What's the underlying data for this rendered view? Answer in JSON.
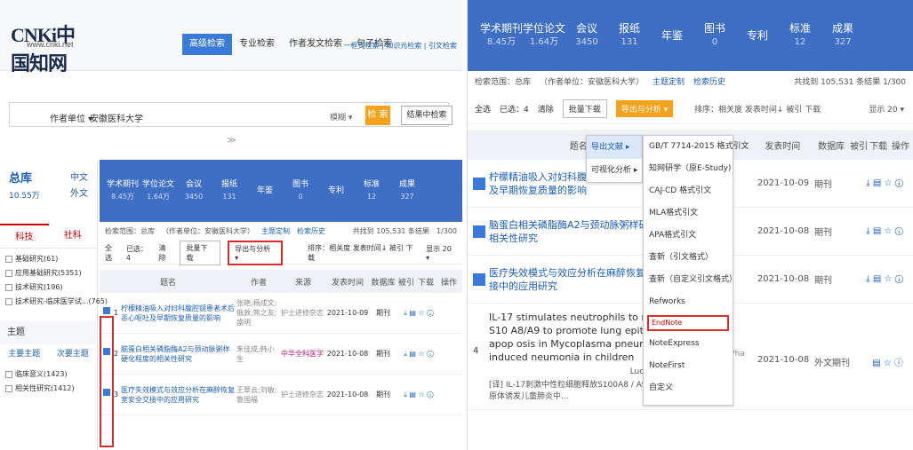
{
  "left": {
    "logo": {
      "mark": "CNKi中国知网",
      "url": "www.cnki.net"
    },
    "search_tabs": [
      "高级检索",
      "专业检索",
      "作者发文检索",
      "句子检索"
    ],
    "top_links": "一框式检索 | 知识元检索 | 引文检索",
    "search": {
      "field": "作者单位 ▾",
      "value": "安徽医科大学",
      "match": "模糊 ▾",
      "button": "检 索",
      "in_result": "结果中检索",
      "expand": "≫"
    },
    "sidebar": {
      "total_title": "总库",
      "total_count": "10.55万",
      "lang_links": [
        "中文",
        "外文"
      ],
      "subject_tabs": [
        "科技",
        "社科"
      ],
      "categories": [
        "基础研究(61)",
        "应用基础研究(5351)",
        "技术研究(196)",
        "技术研究-临床医学试...(765)"
      ],
      "topic_header": "主题",
      "topic_tabs": [
        "主要主题",
        "次要主题"
      ],
      "topics": [
        "临床意义(1423)",
        "相关性研究(1412)"
      ]
    },
    "types": [
      {
        "label": "学术期刊",
        "n": "8.45万"
      },
      {
        "label": "学位论文",
        "n": "1.64万"
      },
      {
        "label": "会议",
        "n": "3450"
      },
      {
        "label": "报纸",
        "n": "131"
      },
      {
        "label": "年鉴",
        "n": ""
      },
      {
        "label": "图书",
        "n": "0"
      },
      {
        "label": "专利",
        "n": ""
      },
      {
        "label": "标准",
        "n": "12"
      },
      {
        "label": "成果",
        "n": "327"
      }
    ],
    "filter": {
      "scope": "检索范围：总库",
      "cond": "（作者单位：安徽医科大学）",
      "custom": "主题定制",
      "history": "检索历史",
      "total": "共找到 105,531 条结果",
      "page": "1/300"
    },
    "toolbar": {
      "select_all": "全选",
      "selected": "已选：4",
      "clear": "清除",
      "batch": "批量下载",
      "export": "导出与分析 ▾",
      "sort": "排序：相关度  发表时间↓ 被引  下载",
      "display": "显示 20 ▾"
    },
    "table_head": [
      "题名",
      "作者",
      "来源",
      "发表时间",
      "数据库",
      "被引",
      "下载",
      "操作"
    ],
    "rows": [
      {
        "idx": "1",
        "title": "柠檬精油吸入对妇科腹腔镜患者术后恶心呕吐及早期恢复质量的影响",
        "author": "张艳;杨成文;俄敦;熊之友;盛明",
        "src": "护士进修杂志",
        "date": "2021-10-09",
        "db": "期刊",
        "ops": "⤓ ▤ ☆ ⓘ"
      },
      {
        "idx": "2",
        "title": "脑蛋白相关磷脂酶A2与颈动脉粥样硬化程度的相关性研究",
        "author": "朱佳成;韩小生",
        "src": "中华全科医学",
        "date": "2021-10-08",
        "db": "期刊",
        "ops": "⤓ ▤ ☆ ⓘ"
      },
      {
        "idx": "3",
        "title": "医疗失效模式与效应分析在麻醉恢复室安全交接中的应用研究",
        "author": "王翠云;刘敏;鲁国福",
        "src": "护士进修杂志",
        "date": "2021-10-08",
        "db": "期刊",
        "ops": "⤓ ▤ ☆ ⓘ"
      }
    ]
  },
  "right": {
    "types": [
      {
        "label": "学术期刊",
        "n": "8.45万"
      },
      {
        "label": "学位论文",
        "n": "1.64万"
      },
      {
        "label": "会议",
        "n": "3450"
      },
      {
        "label": "报纸",
        "n": "131"
      },
      {
        "label": "年鉴",
        "n": ""
      },
      {
        "label": "图书",
        "n": "0"
      },
      {
        "label": "专利",
        "n": ""
      },
      {
        "label": "标准",
        "n": "12"
      },
      {
        "label": "成果",
        "n": "327"
      }
    ],
    "filter": {
      "scope": "检索范围：总库",
      "cond": "（作者单位：安徽医科大学）",
      "custom": "主题定制",
      "history": "检索历史",
      "total": "共找到 105,531 条结果",
      "page": "1/300"
    },
    "toolbar": {
      "select_all": "全选",
      "selected": "已选：4",
      "clear": "清除",
      "batch": "批量下载",
      "export": "导出与分析 ▾",
      "sort": "排序：相关度  发表时间↓ 被引  下载",
      "display": "显示 20 ▾"
    },
    "table_head": [
      "题名",
      "来源",
      "发表时间",
      "数据库",
      "被引",
      "下载",
      "操作"
    ],
    "rows": [
      {
        "title": "柠檬精油吸入对妇科腹腔镜患者术后恶心呕吐及早期恢复质量的影响",
        "src": "进修杂志",
        "date": "2021-10-09",
        "db": "期刊",
        "ops": "⤓ ▤ ☆ ⓘ"
      },
      {
        "title": "脑蛋白相关磷脂酶A2与颈动脉粥样硬化程度的相关性研究",
        "src": "全科医学",
        "date": "2021-10-08",
        "db": "期刊",
        "ops": "⤓ ▤ ☆ ⓘ"
      },
      {
        "title": "医疗失效模式与效应分析在麻醉恢复室安全交接中的应用研究",
        "src": "进修杂志",
        "date": "2021-10-08",
        "db": "期刊",
        "ops": "⤓ ▤ ☆ ⓘ"
      },
      {
        "idx": "4",
        "title": "IL-17 stimulates neutrophils to release S10 A8/A9 to promote lung epithelial cell apop osis in Mycoplasma pneumoniae–induced neumonia in children",
        "author": "Luo;Dong Tao ›",
        "sub": "[译] IL-17刺激中性粒细胞释放S100A8 / A9促进肺炎支原体诱发儿童肺炎中...",
        "src": "edicine & Pha otherapy",
        "date": "2021-10-08",
        "db": "外文期刊",
        "ops": "▤ ☆ ⓘ"
      }
    ],
    "dropdown_main": [
      "导出文献 ▸",
      "可视化分析 ▸"
    ],
    "dropdown_sub": [
      "GB/T 7714-2015 格式引文",
      "知网研学（原E-Study)",
      "CAJ-CD 格式引文",
      "MLA格式引文",
      "APA格式引文",
      "查新（引文格式）",
      "查新（自定义引文格式）",
      "Refworks",
      "EndNote",
      "NoteExpress",
      "NoteFirst",
      "自定义"
    ]
  }
}
